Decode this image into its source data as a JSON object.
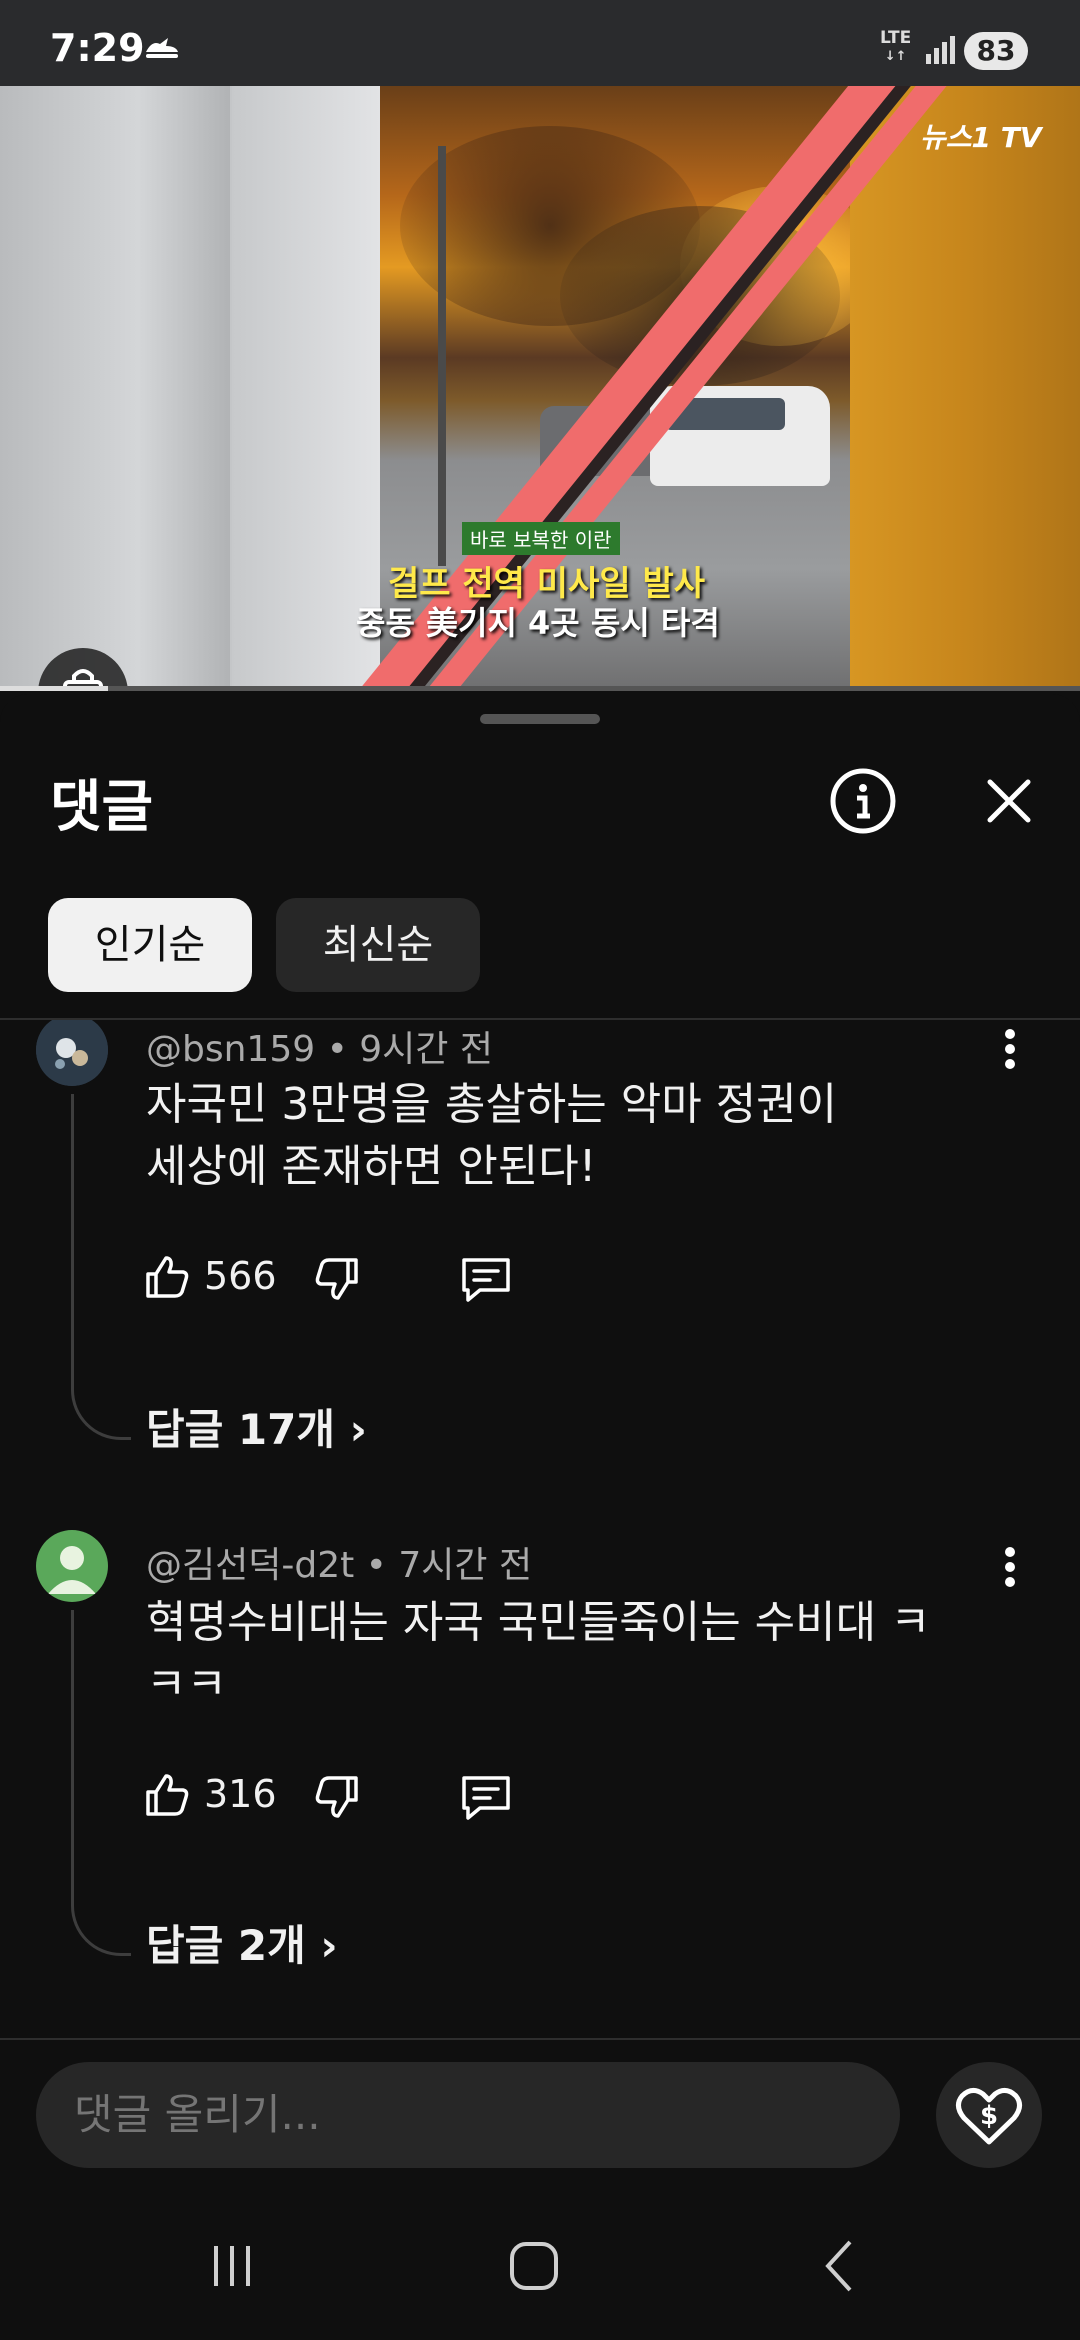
{
  "status_bar": {
    "time": "7:29",
    "network": "LTE",
    "battery": "83"
  },
  "video": {
    "channel_logo": "뉴스1 TV",
    "caption_tag": "바로 보복한 이란",
    "caption_line1": "걸프 전역 미사일 발사",
    "caption_line2": "중동 美기지 4곳 동시 타격",
    "progress": 0.1
  },
  "panel": {
    "title": "댓글",
    "info_icon": "info-icon",
    "close_icon": "close-icon"
  },
  "sort_chips": [
    {
      "label": "인기순",
      "selected": true
    },
    {
      "label": "최신순",
      "selected": false
    }
  ],
  "comments": [
    {
      "author": "@bsn159",
      "time": "9시간 전",
      "text_line1": "자국민 3만명을 총살하는 악마 정권이",
      "text_line2": "세상에 존재하면 안된다!",
      "likes": "566",
      "replies": "답글 17개",
      "avatar_color": "#3a4a5a"
    },
    {
      "author": "@김선덕-d2t",
      "time": "7시간 전",
      "text_line1": "혁명수비대는 자국 국민들죽이는 수비대 ㅋ",
      "text_line2": "ㅋㅋ",
      "likes": "316",
      "replies": "답글 2개",
      "avatar_color": "#5aa85a"
    }
  ],
  "input": {
    "placeholder": "댓글 올리기..."
  },
  "colors": {
    "background": "#0f0f0f",
    "chip_selected": "#f1f1f1",
    "chip_default": "#272727",
    "meta_text": "#aaaaaa"
  }
}
